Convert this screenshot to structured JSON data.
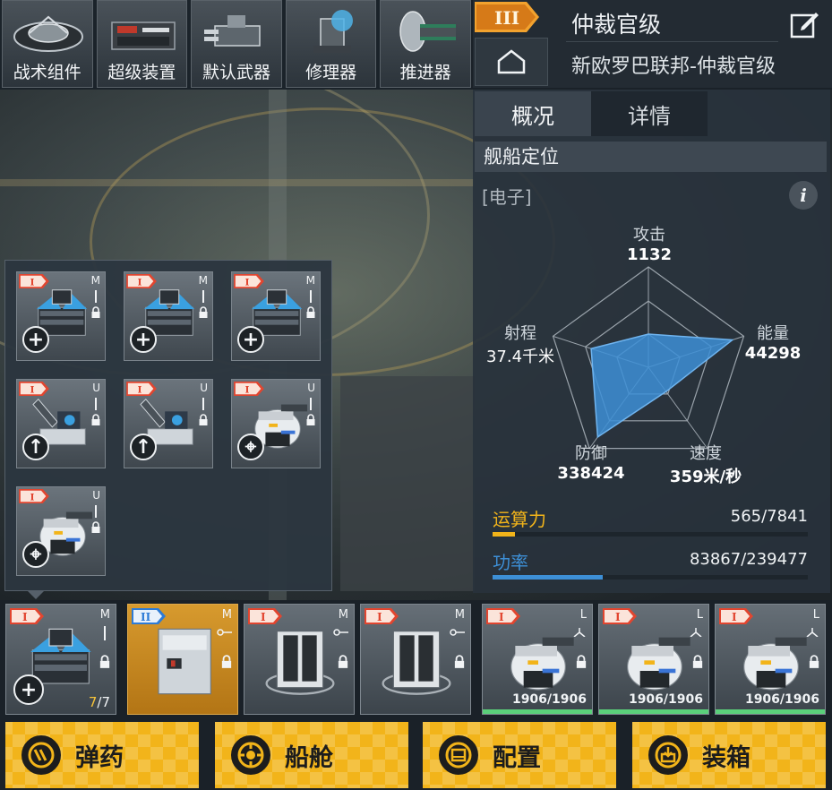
{
  "categories": [
    {
      "label": "战术组件",
      "icon": "tactical-component-icon"
    },
    {
      "label": "超级装置",
      "icon": "super-device-icon"
    },
    {
      "label": "默认武器",
      "icon": "default-weapon-icon"
    },
    {
      "label": "修理器",
      "icon": "repairer-icon"
    },
    {
      "label": "推进器",
      "icon": "thruster-icon"
    }
  ],
  "ship": {
    "tier": "III",
    "name": "仲裁官级",
    "subtitle": "新欧罗巴联邦-仲裁官级"
  },
  "tabs": [
    {
      "label": "概况",
      "active": true
    },
    {
      "label": "详情",
      "active": false
    }
  ],
  "positioning": {
    "title": "舰船定位",
    "role": "[电子]"
  },
  "stats": {
    "attack": {
      "label": "攻击",
      "value": "1132"
    },
    "energy": {
      "label": "能量",
      "value": "44298"
    },
    "speed": {
      "label": "速度",
      "value": "359米/秒"
    },
    "defense": {
      "label": "防御",
      "value": "338424"
    },
    "range": {
      "label": "射程",
      "value": "37.4千米"
    }
  },
  "radar_levels": {
    "attack": 0.33,
    "energy": 0.88,
    "speed": 0.3,
    "defense": 0.86,
    "range": 0.6
  },
  "resources": {
    "compute": {
      "label": "运算力",
      "value": "565/7841",
      "fraction": 0.072,
      "color": "#f2b41a"
    },
    "power": {
      "label": "功率",
      "value": "83867/239477",
      "fraction": 0.35,
      "color": "#3d8fd6"
    }
  },
  "picker_modules": [
    {
      "tier": "I",
      "slot": "M",
      "action": "+",
      "art": "missile-pod"
    },
    {
      "tier": "I",
      "slot": "M",
      "action": "+",
      "art": "missile-pod"
    },
    {
      "tier": "I",
      "slot": "M",
      "action": "+",
      "art": "missile-pod"
    },
    {
      "tier": "I",
      "slot": "U",
      "action": "↑",
      "art": "launcher"
    },
    {
      "tier": "I",
      "slot": "U",
      "action": "↑",
      "art": "launcher"
    },
    {
      "tier": "I",
      "slot": "U",
      "action": "⌖",
      "art": "turret"
    },
    {
      "tier": "I",
      "slot": "U",
      "action": "⌖",
      "art": "turret"
    }
  ],
  "equipped_slots": [
    {
      "tier": "I",
      "slot": "M",
      "art": "missile-pod",
      "count_current": "7",
      "count_total": "/7",
      "action": "+"
    },
    {
      "tier": "II",
      "slot": "M",
      "art": "cargo-box",
      "gold": true
    },
    {
      "tier": "I",
      "slot": "M",
      "art": "locker"
    },
    {
      "tier": "I",
      "slot": "M",
      "art": "locker"
    },
    {
      "tier": "I",
      "slot": "L",
      "art": "turret",
      "hp": "1906/1906"
    },
    {
      "tier": "I",
      "slot": "L",
      "art": "turret",
      "hp": "1906/1906"
    },
    {
      "tier": "I",
      "slot": "L",
      "art": "turret",
      "hp": "1906/1906"
    }
  ],
  "actions": [
    {
      "label": "弹药",
      "icon": "ammo-icon"
    },
    {
      "label": "船舱",
      "icon": "cabin-icon"
    },
    {
      "label": "配置",
      "icon": "config-icon"
    },
    {
      "label": "装箱",
      "icon": "packing-icon"
    }
  ],
  "colors": {
    "accent": "#f2b41a",
    "radar_fill": "#3d8fd6",
    "hp_green": "#5ad07a"
  }
}
